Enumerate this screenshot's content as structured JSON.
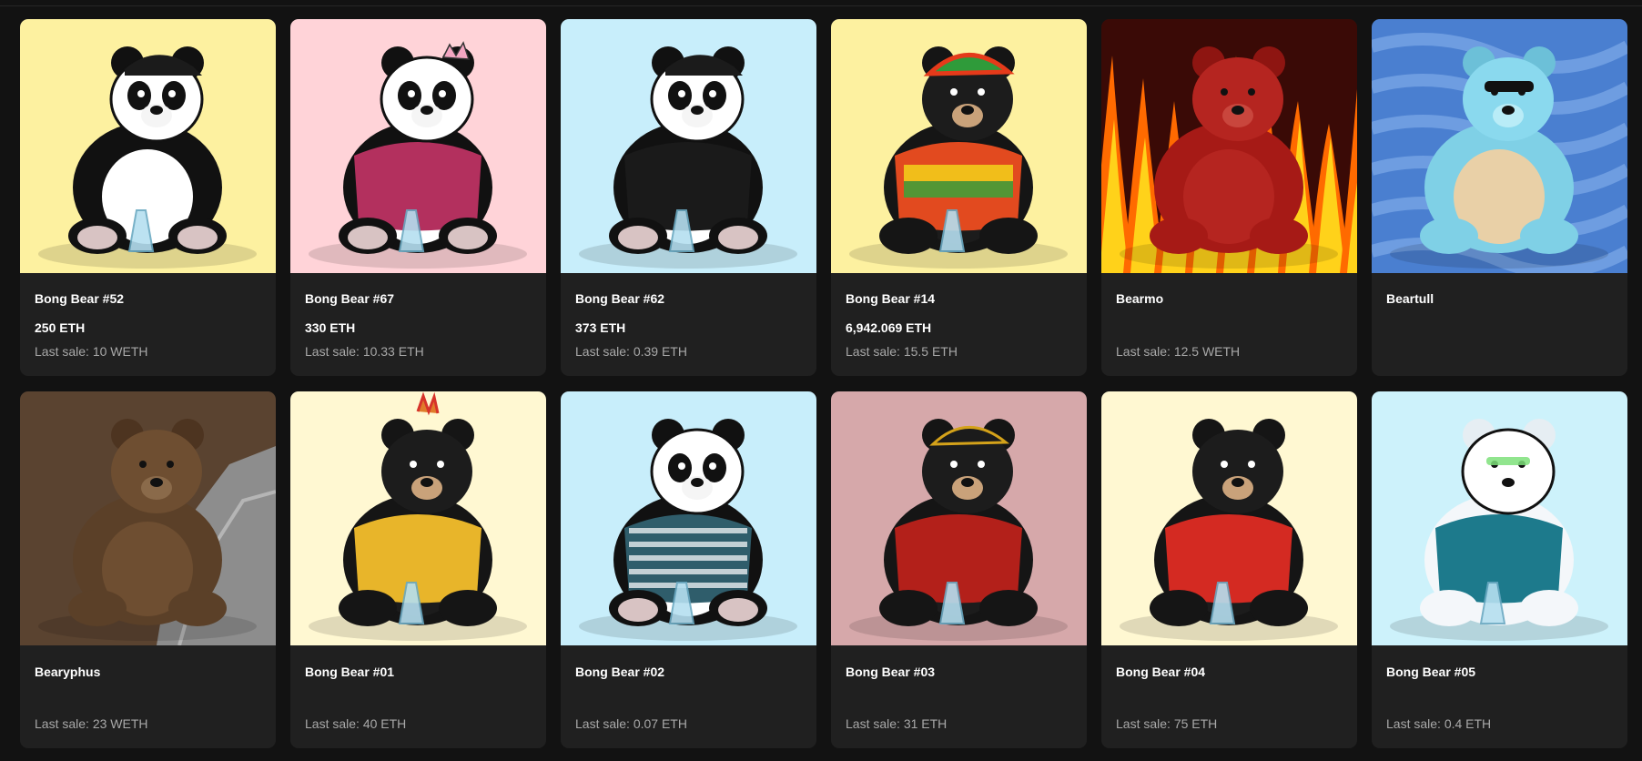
{
  "colors": {
    "page_bg": "#121212",
    "card_bg": "#202020",
    "title_text": "#ffffff",
    "secondary_text": "#a8a8a8"
  },
  "items": [
    {
      "name": "Bong Bear #52",
      "price": "250 ETH",
      "last_sale": "Last sale: 10 WETH",
      "bg": "#fdf1a0",
      "bear": "panda-cap-black",
      "icon": "panda-nft-image"
    },
    {
      "name": "Bong Bear #67",
      "price": "330 ETH",
      "last_sale": "Last sale: 10.33 ETH",
      "bg": "#ffd3d8",
      "bear": "panda-crown-pink-shirt",
      "icon": "panda-nft-image"
    },
    {
      "name": "Bong Bear #62",
      "price": "373 ETH",
      "last_sale": "Last sale: 0.39 ETH",
      "bg": "#c8eefb",
      "bear": "panda-cap-black-shirt",
      "icon": "panda-nft-image"
    },
    {
      "name": "Bong Bear #14",
      "price": "6,942.069 ETH",
      "last_sale": "Last sale: 15.5 ETH",
      "bg": "#fdf1a0",
      "bear": "black-bear-rasta",
      "icon": "black-bear-nft-image"
    },
    {
      "name": "Bearmo",
      "price": "",
      "last_sale": "Last sale: 12.5 WETH",
      "bg": "#3a0a06",
      "bear": "red-bear-flames",
      "icon": "red-bear-nft-image"
    },
    {
      "name": "Beartull",
      "price": "",
      "last_sale": "",
      "bg": "#4a7fd0",
      "bear": "turtle-bear-blue",
      "icon": "turtle-bear-nft-image"
    },
    {
      "name": "Bearyphus",
      "price": "",
      "last_sale": "Last sale: 23 WETH",
      "bg": "#5a4330",
      "bear": "brown-bear-boulder",
      "icon": "brown-bear-nft-image"
    },
    {
      "name": "Bong Bear #01",
      "price": "",
      "last_sale": "Last sale: 40 ETH",
      "bg": "#fff8d2",
      "bear": "black-bear-tiedye",
      "icon": "black-bear-nft-image"
    },
    {
      "name": "Bong Bear #02",
      "price": "",
      "last_sale": "Last sale: 0.07 ETH",
      "bg": "#c8eefb",
      "bear": "panda-striped",
      "icon": "panda-nft-image"
    },
    {
      "name": "Bong Bear #03",
      "price": "",
      "last_sale": "Last sale: 31 ETH",
      "bg": "#d6a8aa",
      "bear": "black-bear-pirate",
      "icon": "black-bear-nft-image"
    },
    {
      "name": "Bong Bear #04",
      "price": "",
      "last_sale": "Last sale: 75 ETH",
      "bg": "#fff8d2",
      "bear": "black-bear-red-jacket",
      "icon": "black-bear-nft-image"
    },
    {
      "name": "Bong Bear #05",
      "price": "",
      "last_sale": "Last sale: 0.4 ETH",
      "bg": "#cdf2fb",
      "bear": "polar-bear-hawaiian",
      "icon": "polar-bear-nft-image"
    }
  ]
}
